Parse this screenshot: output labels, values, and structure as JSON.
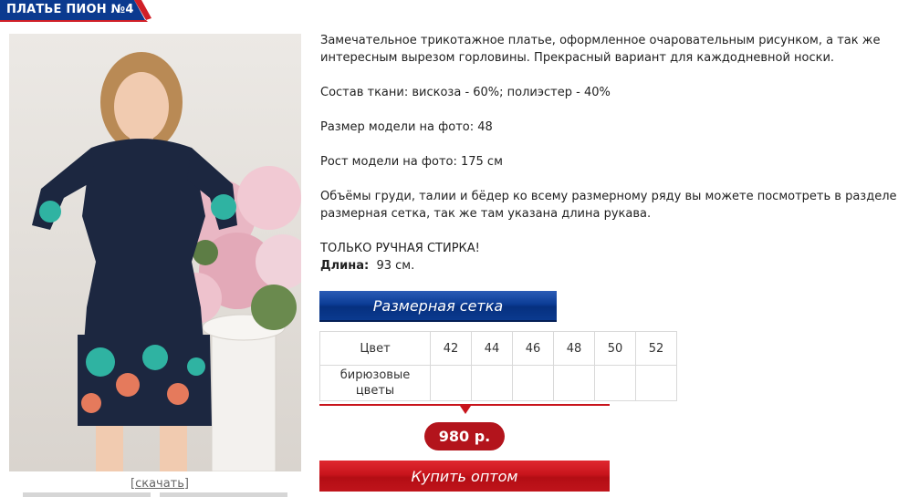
{
  "product": {
    "title": "ПЛАТЬЕ ПИОН №4",
    "download_label": "[скачать]"
  },
  "description": {
    "intro": "Замечательное трикотажное платье, оформленное очаровательным рисунком, а так же интересным вырезом горловины. Прекрасный вариант для каждодневной носки.",
    "composition": "Состав ткани: вискоза - 60%; полиэстер - 40%",
    "model_size": "Размер модели на фото: 48",
    "model_height": "Рост модели на фото: 175 см",
    "measurements_note": "Объёмы груди, талии и бёдер ко всему размерному ряду вы можете посмотреть в разделе размерная сетка, так же там указана длина рукава.",
    "wash_note": "ТОЛЬКО РУЧНАЯ СТИРКА!",
    "length_label": "Длина:",
    "length_value": "93 см."
  },
  "size_grid_button": "Размерная сетка",
  "sizes_table": {
    "color_header": "Цвет",
    "sizes": [
      "42",
      "44",
      "46",
      "48",
      "50",
      "52"
    ],
    "color_name": "бирюзовые цветы"
  },
  "price": "980 р.",
  "buy_button": "Купить оптом",
  "colors": {
    "title_blue": "#0b3a8f",
    "title_red": "#d01f27",
    "button_blue": "#0c3d96",
    "button_red": "#c8141c",
    "price_red": "#b3141c"
  }
}
